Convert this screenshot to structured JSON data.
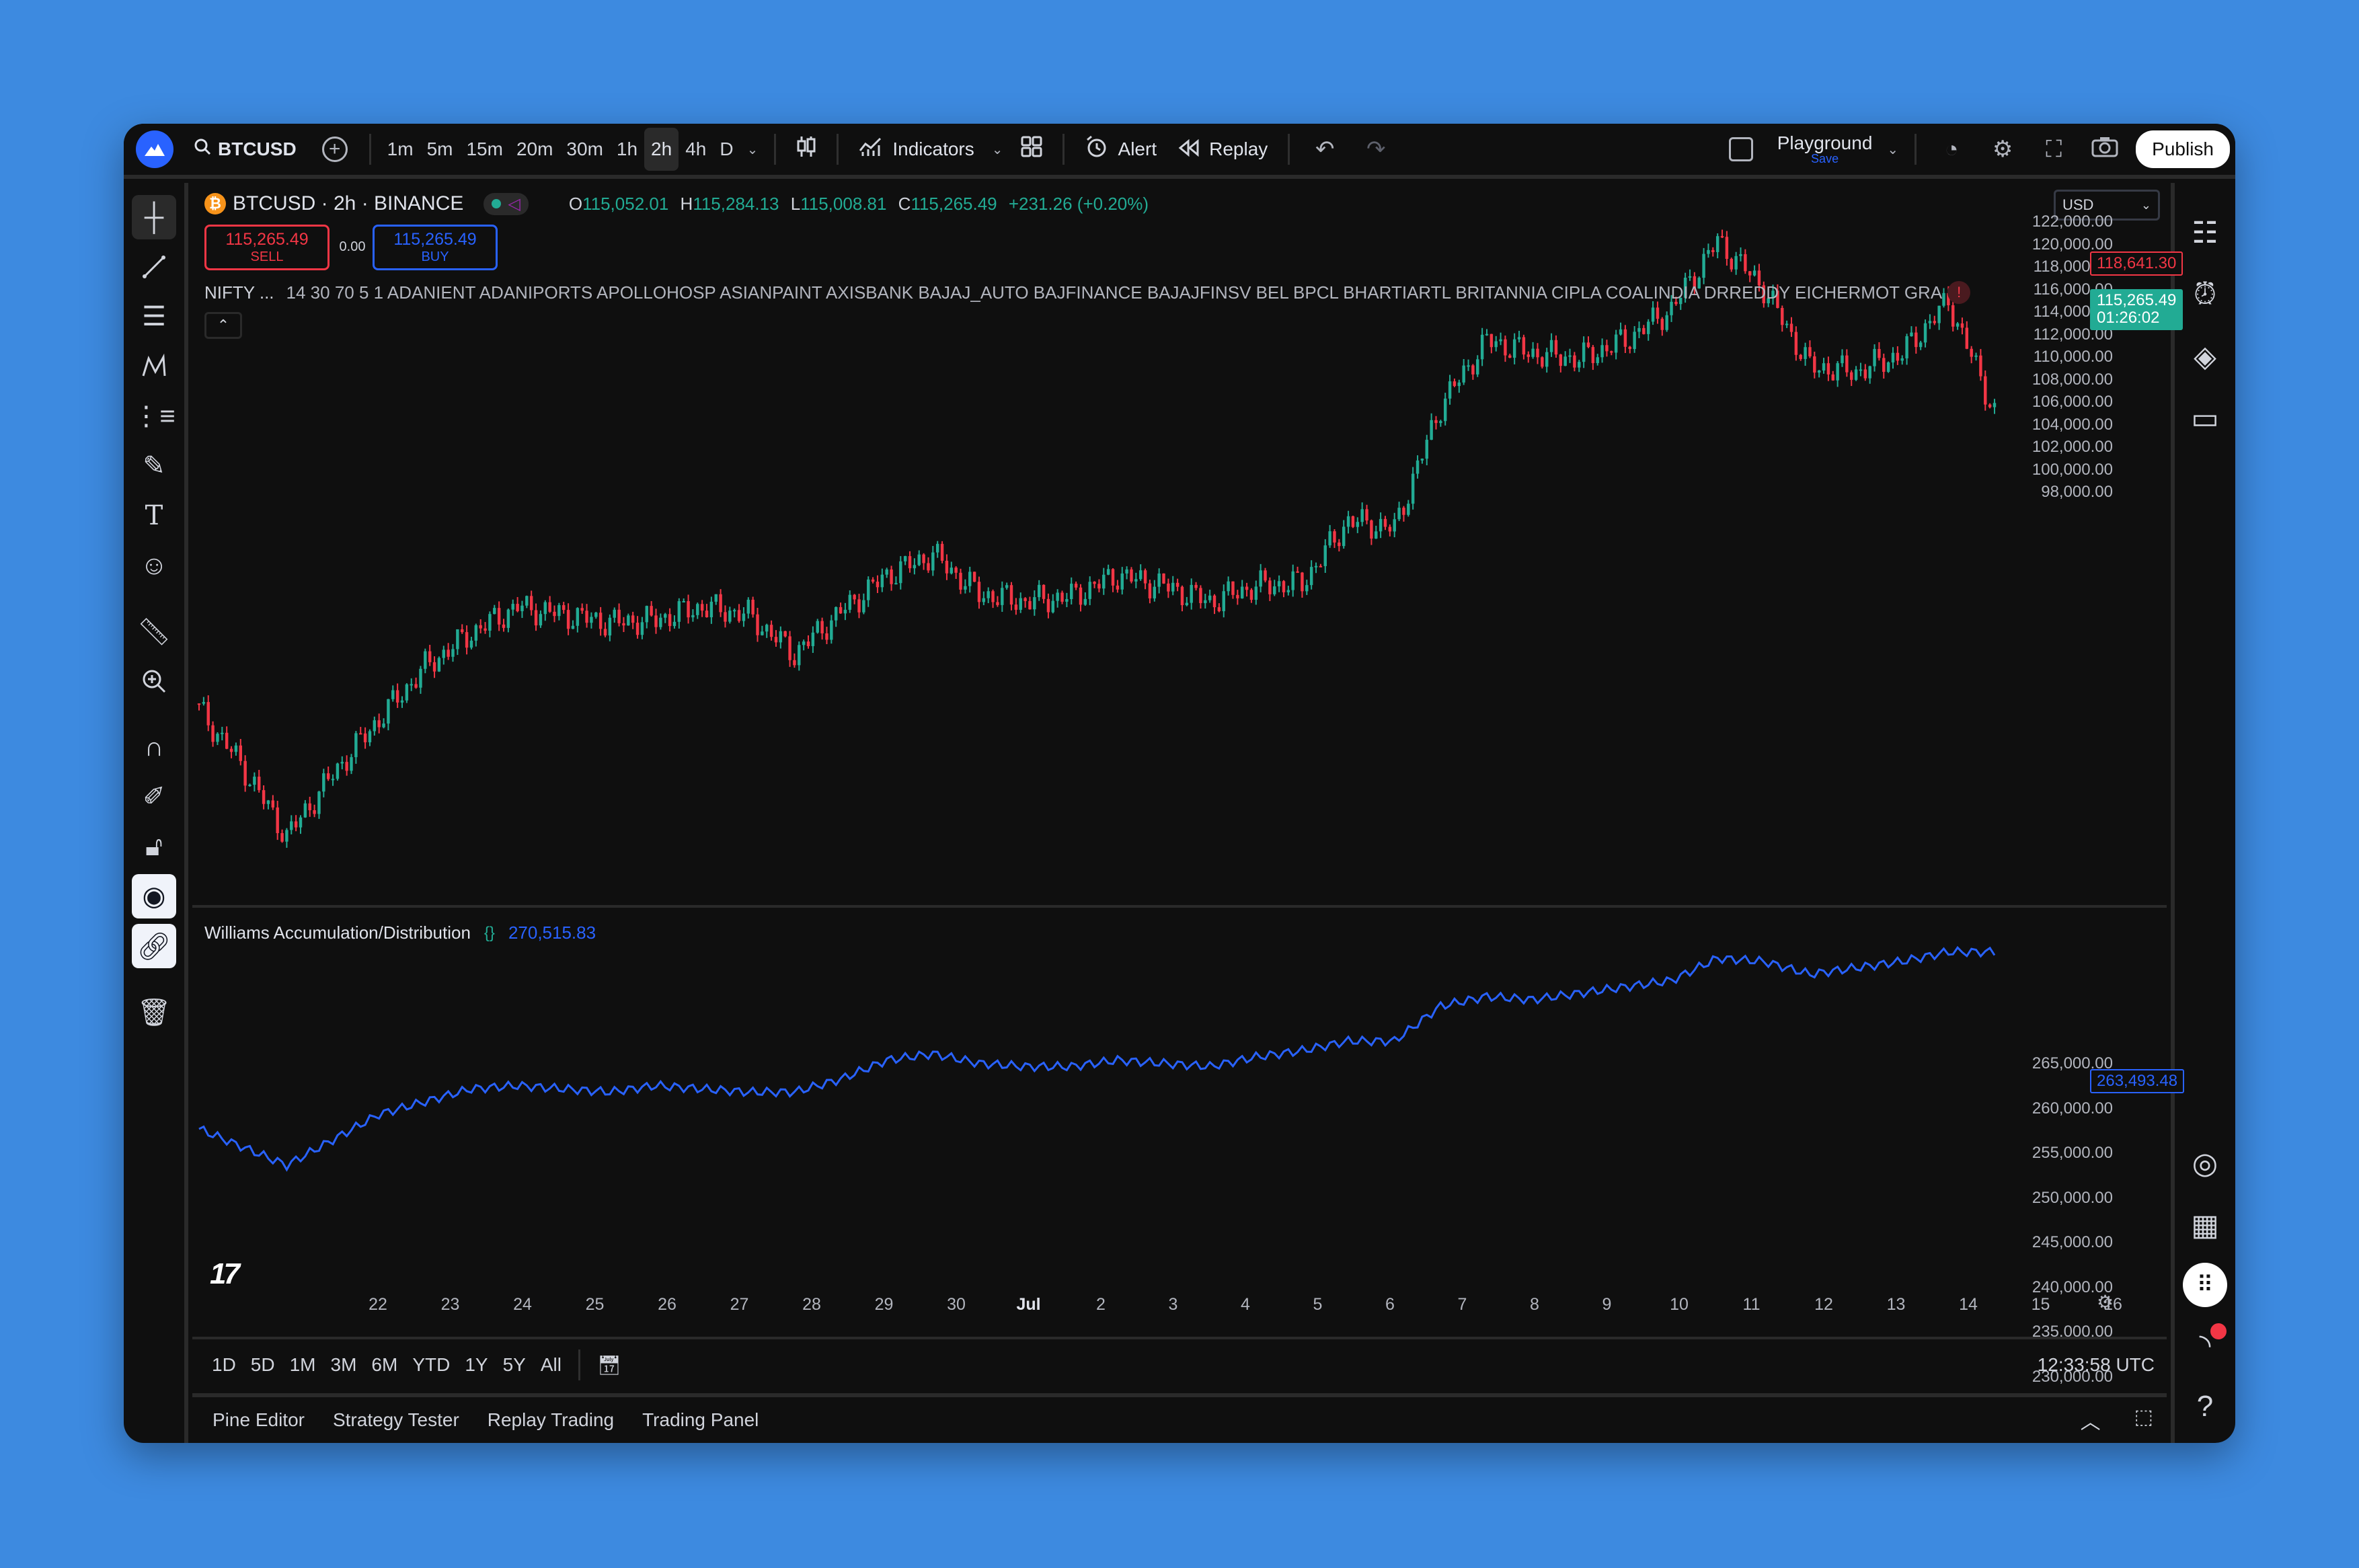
{
  "toolbar": {
    "symbol": "BTCUSD",
    "intervals": [
      "1m",
      "5m",
      "15m",
      "20m",
      "30m",
      "1h",
      "2h",
      "4h",
      "D"
    ],
    "active_interval": "2h",
    "indicators_label": "Indicators",
    "alert_label": "Alert",
    "replay_label": "Replay",
    "layout_name": "Playground",
    "layout_save": "Save",
    "publish_label": "Publish"
  },
  "legend": {
    "title": "BTCUSD · 2h · BINANCE",
    "open_label": "O",
    "open": "115,052.01",
    "high_label": "H",
    "high": "115,284.13",
    "low_label": "L",
    "low": "115,008.81",
    "close_label": "C",
    "close": "115,265.49",
    "change": "+231.26 (+0.20%)"
  },
  "trade": {
    "sell_price": "115,265.49",
    "sell_label": "SELL",
    "spread": "0.00",
    "buy_price": "115,265.49",
    "buy_label": "BUY"
  },
  "nifty_indicator": {
    "name": "NIFTY ...",
    "params": "14 30 70 5 1 ADANIENT ADANIPORTS APOLLOHOSP ASIANPAINT AXISBANK BAJAJ_AUTO BAJFINANCE BAJAJFINSV BEL BPCL BHARTIARTL BRITANNIA CIPLA COALINDIA DRREDDY EICHERMOT GRA",
    "warning": "!"
  },
  "currency": "USD",
  "price_axis": [
    "122,000.00",
    "120,000.00",
    "118,000.00",
    "116,000.00",
    "114,000.00",
    "112,000.00",
    "110,000.00",
    "108,000.00",
    "106,000.00",
    "104,000.00",
    "102,000.00",
    "100,000.00",
    "98,000.00"
  ],
  "price_tags": {
    "high_marker": "118,641.30",
    "last_price": "115,265.49",
    "countdown": "01:26:02"
  },
  "wad": {
    "name": "Williams Accumulation/Distribution",
    "value": "270,515.83",
    "axis": [
      "265,000.00",
      "260,000.00",
      "255,000.00",
      "250,000.00",
      "245,000.00",
      "240,000.00",
      "235,000.00",
      "230,000.00"
    ],
    "last_tag": "263,493.48"
  },
  "date_axis": [
    "22",
    "23",
    "24",
    "25",
    "26",
    "27",
    "28",
    "29",
    "30",
    "Jul",
    "2",
    "3",
    "4",
    "5",
    "6",
    "7",
    "8",
    "9",
    "10",
    "11",
    "12",
    "13",
    "14",
    "15",
    "16"
  ],
  "ranges": [
    "1D",
    "5D",
    "1M",
    "3M",
    "6M",
    "YTD",
    "1Y",
    "5Y",
    "All"
  ],
  "clock": "12:33:58 UTC",
  "bottom_tabs": [
    "Pine Editor",
    "Strategy Tester",
    "Replay Trading",
    "Trading Panel"
  ],
  "colors": {
    "up": "#22ab94",
    "down": "#f23645",
    "wad_line": "#2962ff",
    "background": "#0f0f0f",
    "accent": "#2962ff"
  },
  "chart_data": {
    "type": "candlestick",
    "interval": "2h",
    "x_start": "Jun 21",
    "x_end": "Jul 17",
    "ylim": [
      97000,
      123000
    ],
    "close_points": [
      [
        "Jun 21",
        104100
      ],
      [
        "Jun 22",
        101800
      ],
      [
        "Jun 22",
        99000
      ],
      [
        "Jun 23",
        101400
      ],
      [
        "Jun 23",
        103500
      ],
      [
        "Jun 24",
        105500
      ],
      [
        "Jun 25",
        106800
      ],
      [
        "Jun 26",
        107800
      ],
      [
        "Jun 27",
        107500
      ],
      [
        "Jun 28",
        107200
      ],
      [
        "Jun 29",
        107300
      ],
      [
        "Jun 30",
        107800
      ],
      [
        "Jul 1",
        107500
      ],
      [
        "Jul 1",
        106000
      ],
      [
        "Jul 2",
        107600
      ],
      [
        "Jul 3",
        109000
      ],
      [
        "Jul 4",
        109800
      ],
      [
        "Jul 4",
        108300
      ],
      [
        "Jul 5",
        108000
      ],
      [
        "Jul 6",
        108200
      ],
      [
        "Jul 7",
        109000
      ],
      [
        "Jul 7",
        108600
      ],
      [
        "Jul 8",
        108000
      ],
      [
        "Jul 9",
        108600
      ],
      [
        "Jul 9",
        108700
      ],
      [
        "Jul 10",
        111100
      ],
      [
        "Jul 10",
        110800
      ],
      [
        "Jul 11",
        115500
      ],
      [
        "Jul 11",
        118000
      ],
      [
        "Jul 12",
        117500
      ],
      [
        "Jul 13",
        117300
      ],
      [
        "Jul 13",
        118000
      ],
      [
        "Jul 14",
        119200
      ],
      [
        "Jul 14",
        121800
      ],
      [
        "Jul 14",
        120000
      ],
      [
        "Jul 15",
        117000
      ],
      [
        "Jul 15",
        116800
      ],
      [
        "Jul 16",
        117500
      ],
      [
        "Jul 16",
        119500
      ],
      [
        "Jul 17",
        115265
      ]
    ],
    "wad_points": [
      [
        "Jun 21",
        236000
      ],
      [
        "Jun 22",
        233000
      ],
      [
        "Jun 22",
        230000
      ],
      [
        "Jun 23",
        234000
      ],
      [
        "Jun 23",
        238000
      ],
      [
        "Jun 24",
        240000
      ],
      [
        "Jun 25",
        242000
      ],
      [
        "Jun 26",
        242500
      ],
      [
        "Jun 27",
        242000
      ],
      [
        "Jun 28",
        241500
      ],
      [
        "Jun 29",
        242500
      ],
      [
        "Jun 30",
        242000
      ],
      [
        "Jul 1",
        241500
      ],
      [
        "Jul 1",
        241500
      ],
      [
        "Jul 2",
        243500
      ],
      [
        "Jul 3",
        246500
      ],
      [
        "Jul 4",
        247500
      ],
      [
        "Jul 4",
        246000
      ],
      [
        "Jul 5",
        245500
      ],
      [
        "Jul 6",
        245500
      ],
      [
        "Jul 7",
        246500
      ],
      [
        "Jul 7",
        246000
      ],
      [
        "Jul 8",
        245500
      ],
      [
        "Jul 9",
        247000
      ],
      [
        "Jul 9",
        248000
      ],
      [
        "Jul 10",
        249500
      ],
      [
        "Jul 10",
        249500
      ],
      [
        "Jul 11",
        255000
      ],
      [
        "Jul 11",
        256500
      ],
      [
        "Jul 12",
        256000
      ],
      [
        "Jul 13",
        257000
      ],
      [
        "Jul 13",
        258000
      ],
      [
        "Jul 14",
        259000
      ],
      [
        "Jul 14",
        262500
      ],
      [
        "Jul 14",
        262000
      ],
      [
        "Jul 15",
        260000
      ],
      [
        "Jul 15",
        261000
      ],
      [
        "Jul 16",
        262000
      ],
      [
        "Jul 16",
        263500
      ],
      [
        "Jul 17",
        263493
      ]
    ]
  }
}
